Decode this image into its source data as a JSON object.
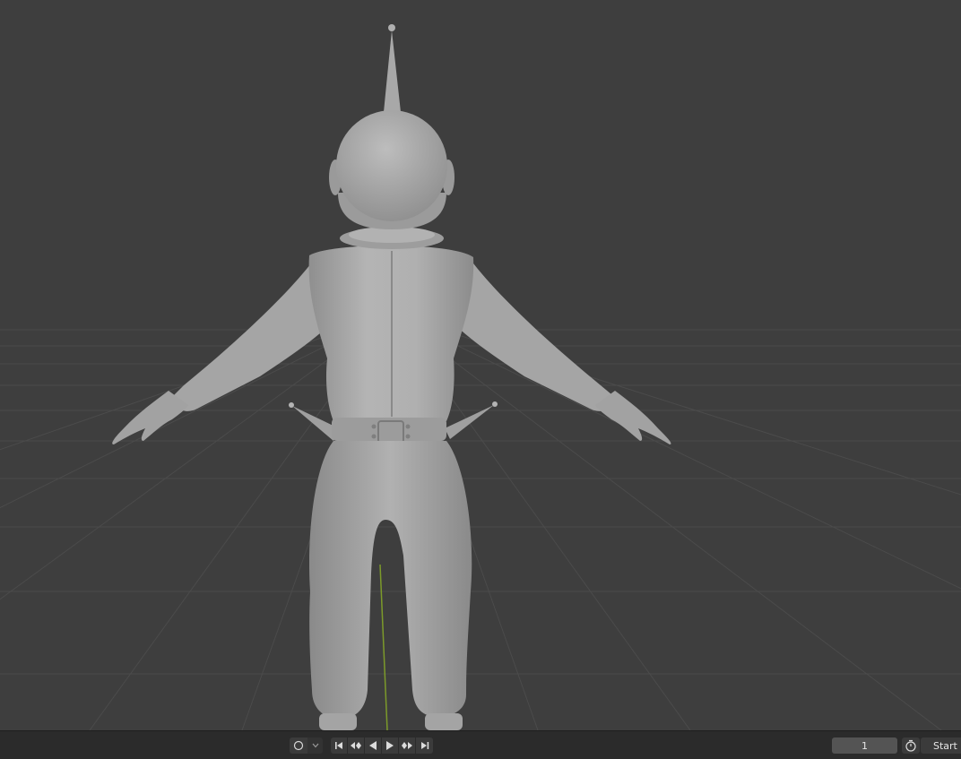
{
  "viewport": {
    "background": "#3e3e3e",
    "grid_color": "#4a4a4a",
    "axis_y_color": "#7c9a2a",
    "model_color": "#a7a7a7"
  },
  "timeline": {
    "keying_icon": "circle-icon",
    "keying_dropdown_icon": "chevron-down-icon",
    "playback": [
      {
        "name": "jump-to-start",
        "icon": "jump-start-icon"
      },
      {
        "name": "jump-to-previous-keyframe",
        "icon": "prev-keyframe-icon"
      },
      {
        "name": "play-reverse",
        "icon": "play-reverse-icon"
      },
      {
        "name": "play",
        "icon": "play-icon"
      },
      {
        "name": "jump-to-next-keyframe",
        "icon": "next-keyframe-icon"
      },
      {
        "name": "jump-to-end",
        "icon": "jump-end-icon"
      }
    ],
    "current_frame": "1",
    "stopwatch_icon": "stopwatch-icon",
    "start_label": "Start"
  }
}
